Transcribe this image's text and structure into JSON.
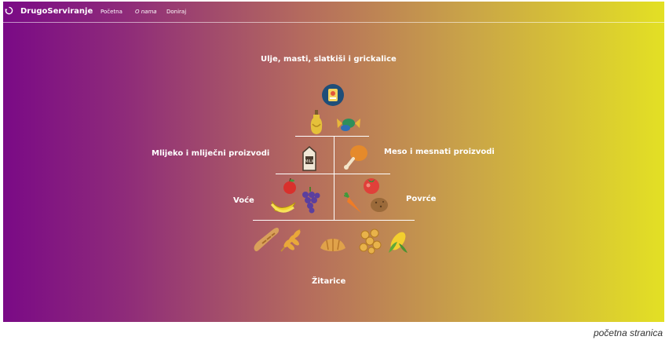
{
  "navbar": {
    "brand": "DrugoServiranje",
    "links": [
      "Početna",
      "O nama",
      "Doniraj"
    ]
  },
  "pyramid": {
    "top_label": "Ulje, masti, slatkiši i grickalice",
    "dairy_label": "Mlijeko i mliječni proizvodi",
    "meat_label": "Meso i mesnati proizvodi",
    "fruit_label": "Voće",
    "veg_label": "Povrće",
    "grain_label": "Žitarice",
    "icons": {
      "top": [
        "chips-icon",
        "oil-bottle-icon",
        "candy-icon"
      ],
      "dairy": [
        "milk-carton-icon"
      ],
      "meat": [
        "chicken-leg-icon"
      ],
      "fruit": [
        "apple-icon",
        "banana-icon",
        "grapes-icon"
      ],
      "veg": [
        "tomato-icon",
        "carrot-icon",
        "potato-icon"
      ],
      "grain": [
        "baguette-icon",
        "wheat-icon",
        "croissant-icon",
        "pasta-icon",
        "corn-icon"
      ]
    }
  },
  "caption": "početna stranica"
}
